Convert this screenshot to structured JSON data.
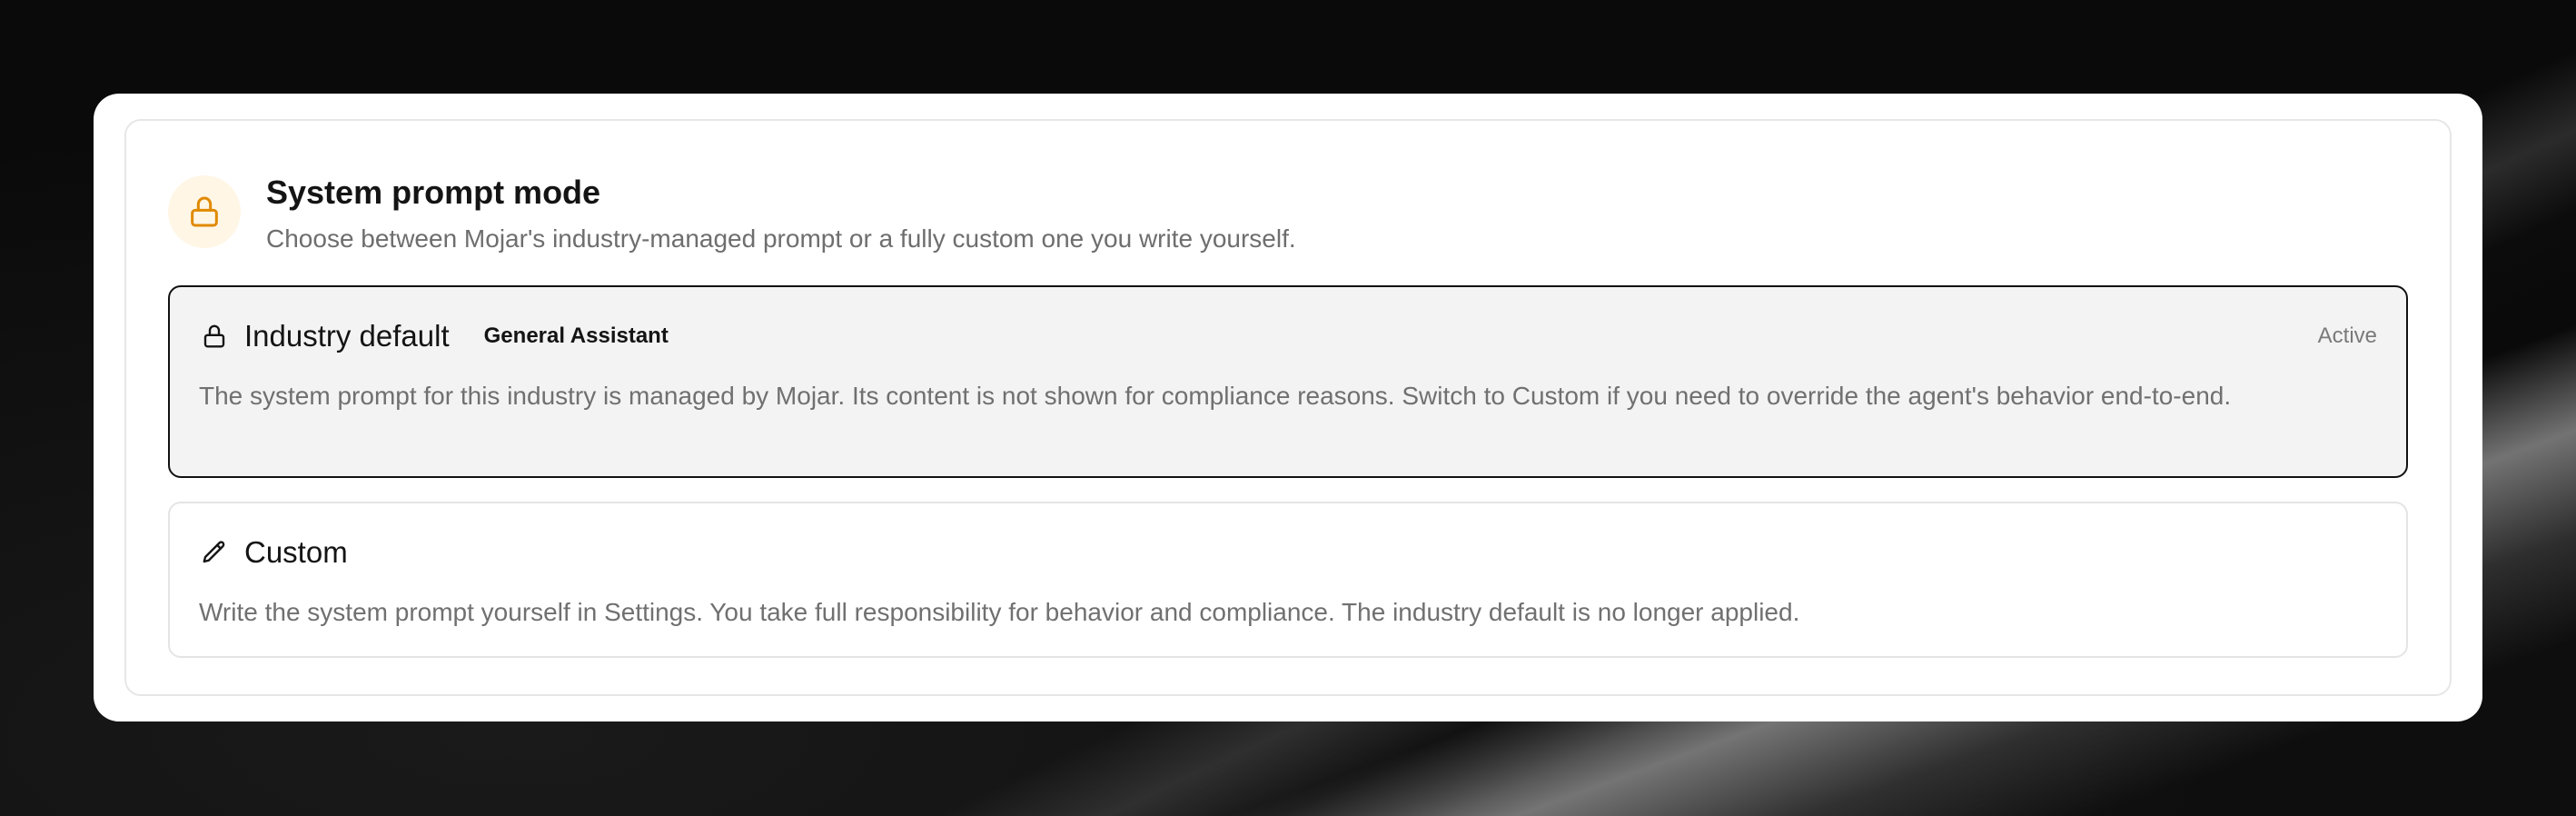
{
  "header": {
    "icon": "lock-icon",
    "icon_color": "#e08a00",
    "title": "System prompt mode",
    "subtitle": "Choose between Mojar's industry-managed prompt or a fully custom one you write yourself."
  },
  "options": [
    {
      "icon": "lock-icon",
      "title": "Industry default",
      "badge": "General Assistant",
      "status": "Active",
      "selected": true,
      "description": "The system prompt for this industry is managed by Mojar. Its content is not shown for compliance reasons. Switch to Custom if you need to override the agent's behavior end-to-end."
    },
    {
      "icon": "pencil-icon",
      "title": "Custom",
      "selected": false,
      "description": "Write the system prompt yourself in Settings. You take full responsibility for behavior and compliance. The industry default is no longer applied."
    }
  ]
}
